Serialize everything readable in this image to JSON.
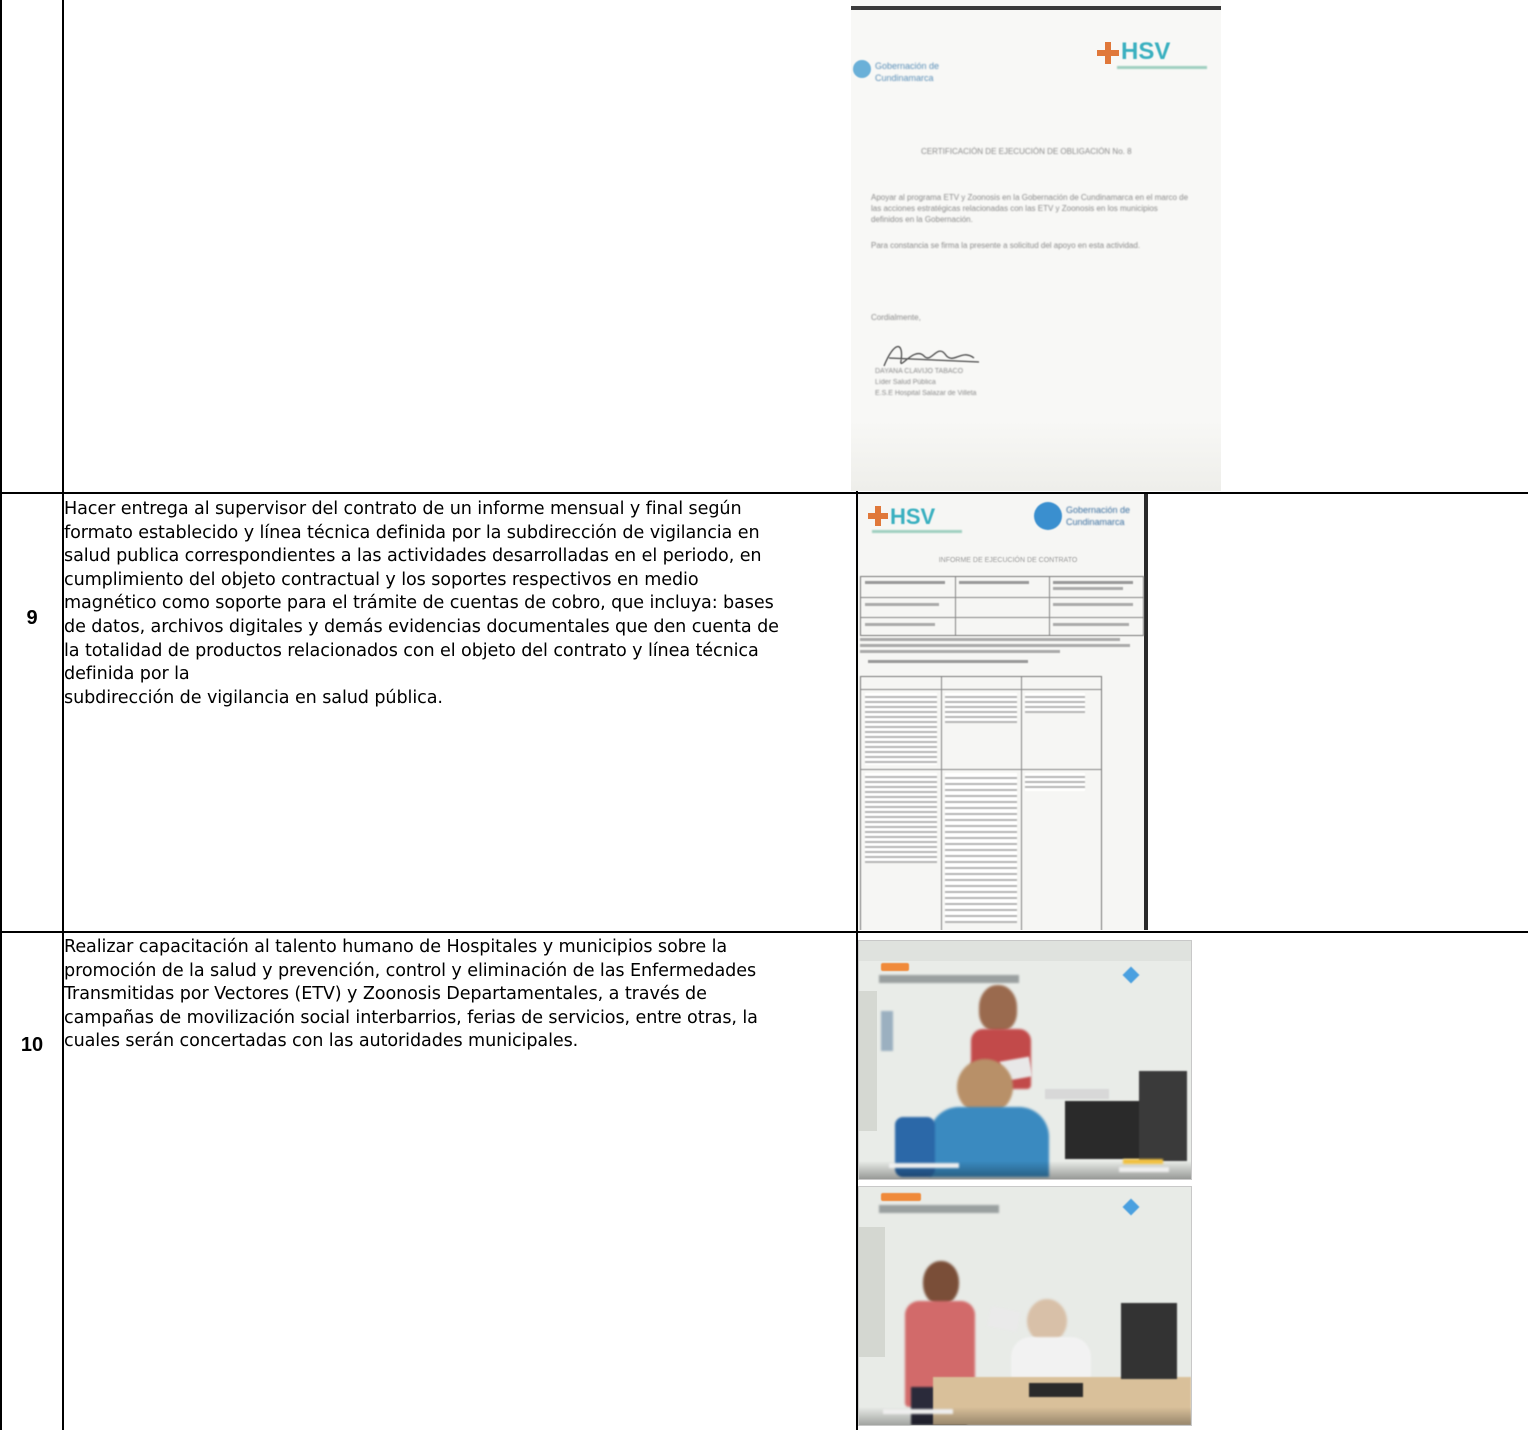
{
  "rows": [
    {
      "number": "",
      "description": ""
    },
    {
      "number": "9",
      "description": "Hacer entrega al supervisor del contrato de un informe mensual  y final según\nformato establecido  y línea técnica definida por la subdirección de vigilancia en\nsalud publica correspondientes a las actividades desarrolladas en el periodo, en\ncumplimiento del objeto contractual y los soportes respectivos en medio\nmagnético como soporte para el trámite de cuentas de cobro, que incluya: bases\nde datos, archivos digitales  y demás evidencias documentales que den cuenta de\nla totalidad de productos relacionados con el objeto del contrato y línea técnica\ndefinida por la\nsubdirección de vigilancia en salud pública."
    },
    {
      "number": "10",
      "description": "Realizar capacitación al talento humano de Hospitales y municipios sobre la\npromoción  de la salud y prevención, control y eliminación de las Enfermedades\nTransmitidas por Vectores (ETV) y Zoonosis Departamentales, a través de\ncampañas de movilización social interbarrios, ferias de servicios, entre otras, la\ncuales serán concertadas con las autoridades municipales."
    }
  ],
  "evidence": {
    "certificate": {
      "logo_left": "Gobernación de Cundinamarca",
      "logo_right": "HSV",
      "title": "CERTIFICACIÓN DE EJECUCIÓN DE OBLIGACIÓN No. 8",
      "body_1": "Apoyar al programa ETV y Zoonosis en la Gobernación de Cundinamarca en el marco de las acciones estratégicas relacionadas con las ETV y Zoonosis en los municipios definidos en la Gobernación.",
      "body_2": "Para constancia se firma la presente a solicitud del apoyo en esta actividad.",
      "closing": "Cordialmente,",
      "signer_name": "DAYANA CLAVIJO TABACO",
      "signer_role": "Líder Salud Pública",
      "signer_org": "E.S.E Hospital Salazar de Villeta"
    },
    "report": {
      "logo_left": "HSV",
      "logo_right": "Gobernación de Cundinamarca",
      "title": "INFORME DE EJECUCIÓN DE CONTRATO"
    }
  }
}
